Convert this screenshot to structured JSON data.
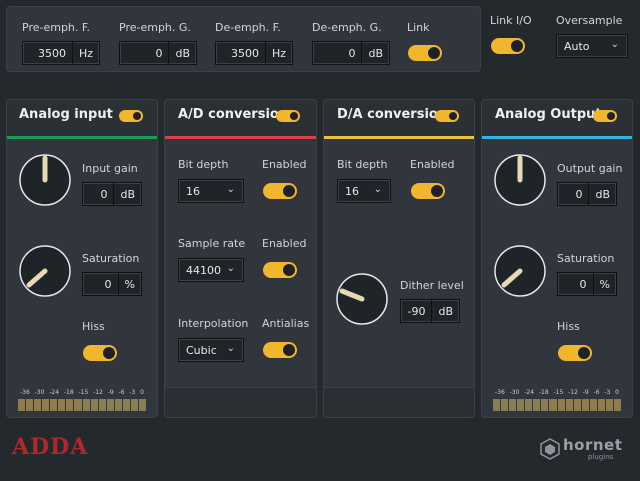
{
  "topbar": {
    "pre_emph_f": {
      "label": "Pre-emph. F.",
      "value": "3500",
      "unit": "Hz"
    },
    "pre_emph_g": {
      "label": "Pre-emph. G.",
      "value": "0",
      "unit": "dB"
    },
    "de_emph_f": {
      "label": "De-emph. F.",
      "value": "3500",
      "unit": "Hz"
    },
    "de_emph_g": {
      "label": "De-emph. G.",
      "value": "0",
      "unit": "dB"
    },
    "link_label": "Link"
  },
  "link_io_label": "Link I/O",
  "oversample": {
    "label": "Oversample",
    "value": "Auto"
  },
  "analog_input": {
    "title": "Analog input",
    "input_gain": {
      "label": "Input gain",
      "value": "0",
      "unit": "dB"
    },
    "saturation": {
      "label": "Saturation",
      "value": "0",
      "unit": "%"
    },
    "hiss_label": "Hiss"
  },
  "ad_conversion": {
    "title": "A/D conversion",
    "bit_depth": {
      "label": "Bit depth",
      "value": "16"
    },
    "bit_enabled_label": "Enabled",
    "sample_rate": {
      "label": "Sample rate",
      "value": "44100"
    },
    "rate_enabled_label": "Enabled",
    "interpolation": {
      "label": "Interpolation",
      "value": "Cubic"
    },
    "antialias_label": "Antialias"
  },
  "da_conversion": {
    "title": "D/A conversion",
    "bit_depth": {
      "label": "Bit depth",
      "value": "16"
    },
    "enabled_label": "Enabled",
    "dither_level": {
      "label": "Dither level",
      "value": "-90",
      "unit": "dB"
    }
  },
  "analog_output": {
    "title": "Analog Output",
    "output_gain": {
      "label": "Output gain",
      "value": "0",
      "unit": "dB"
    },
    "saturation": {
      "label": "Saturation",
      "value": "0",
      "unit": "%"
    },
    "hiss_label": "Hiss"
  },
  "meter_ticks": [
    "-36",
    "-30",
    "-24",
    "-18",
    "-15",
    "-12",
    "-9",
    "-6",
    "-3",
    "0"
  ],
  "brand": {
    "product": "ADDA",
    "vendor": "hornet",
    "vendor_sub": "plugins"
  },
  "colors": {
    "accent": "#f2b52e",
    "analog_input_bar": "#1f9a58",
    "ad_bar": "#d8434a",
    "da_bar": "#e8c23a",
    "analog_output_bar": "#2fb6dc",
    "product_logo": "#b1272a"
  },
  "icons": {
    "toggle": "toggle-switch",
    "chevron": "chevron-down-icon",
    "vendor_logo": "hornet-logo-icon"
  }
}
